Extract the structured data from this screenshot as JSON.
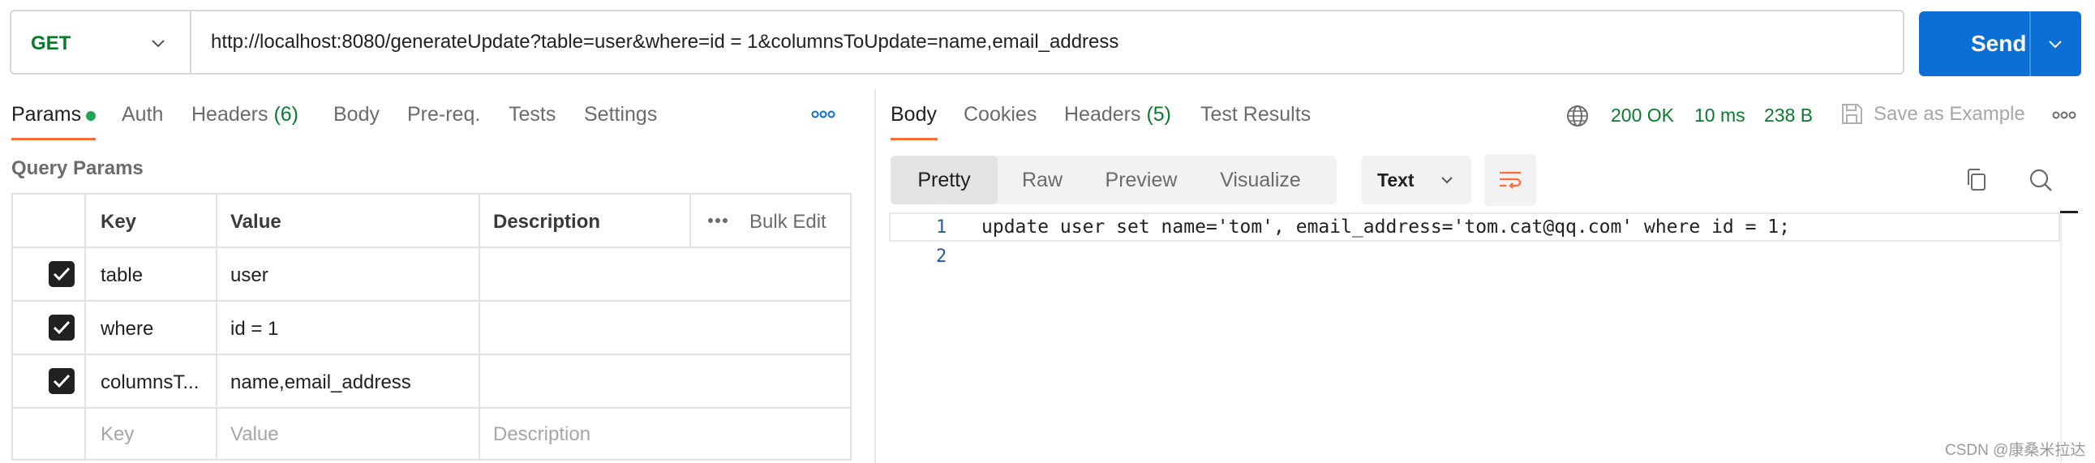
{
  "request": {
    "method": "GET",
    "url": "http://localhost:8080/generateUpdate?table=user&where=id = 1&columnsToUpdate=name,email_address",
    "send_label": "Send"
  },
  "request_tabs": [
    {
      "label": "Params",
      "active": true
    },
    {
      "label": "Auth"
    },
    {
      "label": "Headers",
      "count": "(6)"
    },
    {
      "label": "Body"
    },
    {
      "label": "Pre-req."
    },
    {
      "label": "Tests"
    },
    {
      "label": "Settings"
    }
  ],
  "query_params": {
    "title": "Query Params",
    "headers": {
      "key": "Key",
      "value": "Value",
      "description": "Description",
      "bulk_edit": "Bulk Edit"
    },
    "rows": [
      {
        "checked": true,
        "key": "table",
        "value": "user",
        "description": ""
      },
      {
        "checked": true,
        "key": "where",
        "value": "id = 1",
        "description": ""
      },
      {
        "checked": true,
        "key": "columnsT...",
        "value": "name,email_address",
        "description": ""
      }
    ],
    "placeholders": {
      "key": "Key",
      "value": "Value",
      "description": "Description"
    }
  },
  "response_tabs": [
    {
      "label": "Body",
      "active": true
    },
    {
      "label": "Cookies"
    },
    {
      "label": "Headers",
      "count": "(5)"
    },
    {
      "label": "Test Results"
    }
  ],
  "response_status": {
    "status": "200 OK",
    "time": "10 ms",
    "size": "238 B",
    "save_label": "Save as Example"
  },
  "view_modes": [
    {
      "label": "Pretty",
      "active": true
    },
    {
      "label": "Raw"
    },
    {
      "label": "Preview"
    },
    {
      "label": "Visualize"
    }
  ],
  "format": "Text",
  "editor": {
    "lines": [
      {
        "num": "1",
        "text": "update user set name='tom', email_address='tom.cat@qq.com' where id = 1;"
      },
      {
        "num": "2",
        "text": ""
      }
    ]
  },
  "watermark": "CSDN @康桑米拉达",
  "colors": {
    "accent": "#ff6c37",
    "send": "#0b6fd6",
    "method": "#0a7a2f",
    "status": "#0a7a2f"
  },
  "icons": [
    "chevron-down-icon",
    "more-icon",
    "globe-icon",
    "save-icon",
    "wrap-lines-icon",
    "copy-icon",
    "search-icon",
    "checkmark-icon"
  ]
}
